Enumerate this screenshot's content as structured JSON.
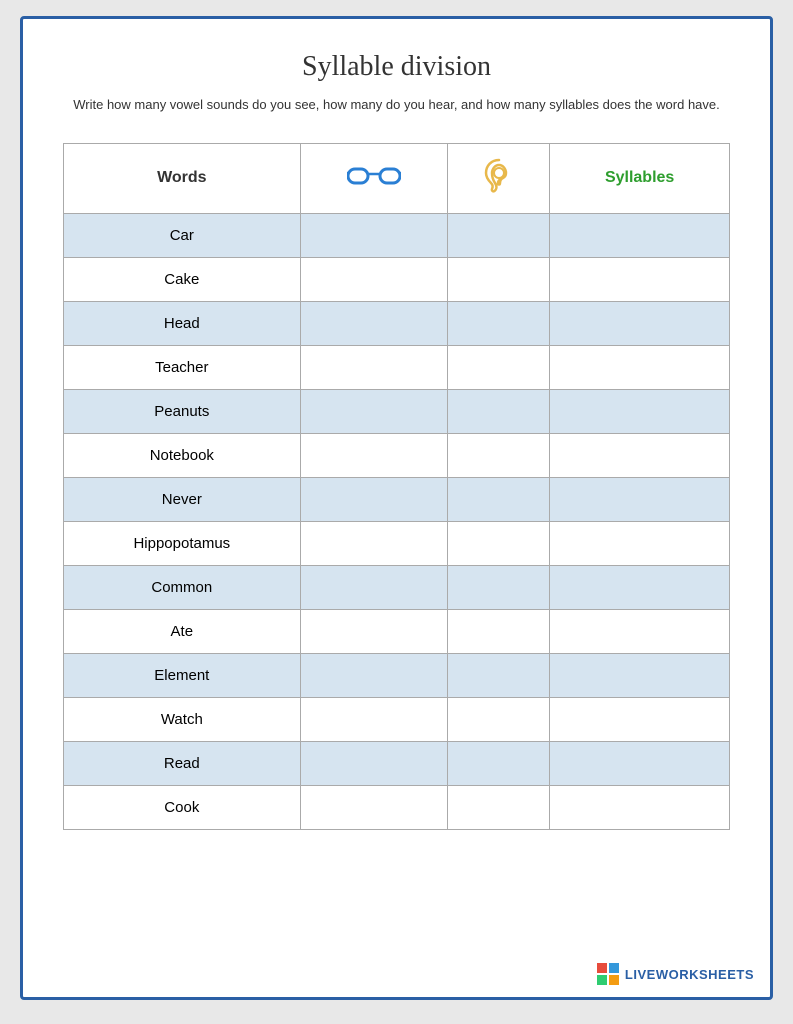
{
  "page": {
    "title": "Syllable division",
    "instructions": "Write how many vowel sounds do you see, how many do you hear, and how many syllables does the word have.",
    "footer": {
      "logo_text": "LIVEWORKSHEETS"
    }
  },
  "table": {
    "headers": {
      "words": "Words",
      "syllables": "Syllables"
    },
    "rows": [
      {
        "word": "Car",
        "shaded": true
      },
      {
        "word": "Cake",
        "shaded": false
      },
      {
        "word": "Head",
        "shaded": true
      },
      {
        "word": "Teacher",
        "shaded": false
      },
      {
        "word": "Peanuts",
        "shaded": true
      },
      {
        "word": "Notebook",
        "shaded": false
      },
      {
        "word": "Never",
        "shaded": true
      },
      {
        "word": "Hippopotamus",
        "shaded": false
      },
      {
        "word": "Common",
        "shaded": true
      },
      {
        "word": "Ate",
        "shaded": false
      },
      {
        "word": "Element",
        "shaded": true
      },
      {
        "word": "Watch",
        "shaded": false
      },
      {
        "word": "Read",
        "shaded": true
      },
      {
        "word": "Cook",
        "shaded": false
      }
    ]
  }
}
